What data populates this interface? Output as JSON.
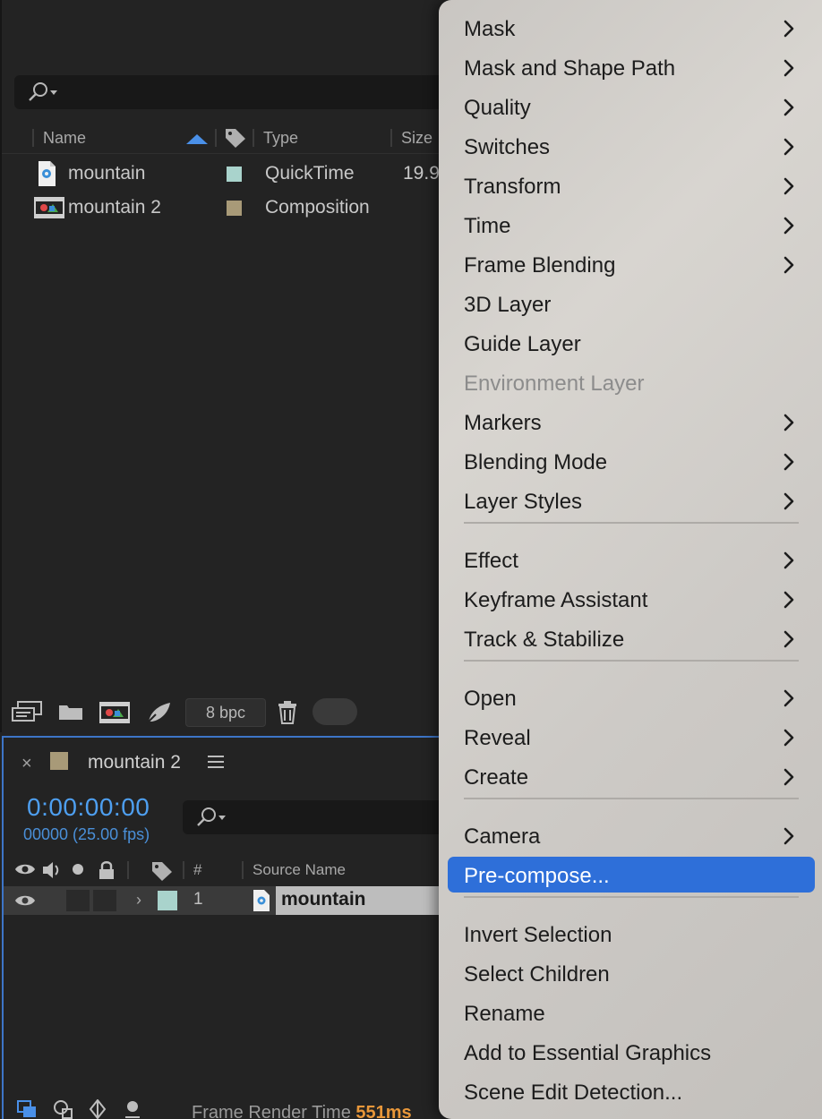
{
  "project": {
    "columns": [
      "Name",
      "Type",
      "Size"
    ],
    "items": [
      {
        "name": "mountain",
        "type": "QuickTime",
        "size": "19.9",
        "label_color": "#a9d3cc",
        "icon": "quicktime-file-icon"
      },
      {
        "name": "mountain 2",
        "type": "Composition",
        "size": "",
        "label_color": "#a89a78",
        "icon": "composition-icon"
      }
    ],
    "footer": {
      "bpc": "8 bpc"
    }
  },
  "timeline": {
    "tab_title": "mountain 2",
    "close": "×",
    "timecode": "0:00:00:00",
    "fps": "00000 (25.00 fps)",
    "columns": {
      "num": "#",
      "source": "Source Name"
    },
    "layer": {
      "index": "1",
      "name": "mountain",
      "chevron": "›"
    },
    "footer": {
      "render_label": "Frame Render Time",
      "render_value": "551ms"
    }
  },
  "menu": {
    "groups": [
      [
        {
          "label": "Mask",
          "submenu": true
        },
        {
          "label": "Mask and Shape Path",
          "submenu": true
        },
        {
          "label": "Quality",
          "submenu": true
        },
        {
          "label": "Switches",
          "submenu": true
        },
        {
          "label": "Transform",
          "submenu": true
        },
        {
          "label": "Time",
          "submenu": true
        },
        {
          "label": "Frame Blending",
          "submenu": true
        },
        {
          "label": "3D Layer",
          "submenu": false
        },
        {
          "label": "Guide Layer",
          "submenu": false
        },
        {
          "label": "Environment Layer",
          "submenu": false,
          "disabled": true
        },
        {
          "label": "Markers",
          "submenu": true
        },
        {
          "label": "Blending Mode",
          "submenu": true
        },
        {
          "label": "Layer Styles",
          "submenu": true
        }
      ],
      [
        {
          "label": "Effect",
          "submenu": true
        },
        {
          "label": "Keyframe Assistant",
          "submenu": true
        },
        {
          "label": "Track & Stabilize",
          "submenu": true
        }
      ],
      [
        {
          "label": "Open",
          "submenu": true
        },
        {
          "label": "Reveal",
          "submenu": true
        },
        {
          "label": "Create",
          "submenu": true
        }
      ],
      [
        {
          "label": "Camera",
          "submenu": true
        },
        {
          "label": "Pre-compose...",
          "submenu": false,
          "selected": true
        }
      ],
      [
        {
          "label": "Invert Selection",
          "submenu": false
        },
        {
          "label": "Select Children",
          "submenu": false
        },
        {
          "label": "Rename",
          "submenu": false
        },
        {
          "label": "Add to Essential Graphics",
          "submenu": false
        },
        {
          "label": "Scene Edit Detection...",
          "submenu": false
        }
      ]
    ]
  }
}
